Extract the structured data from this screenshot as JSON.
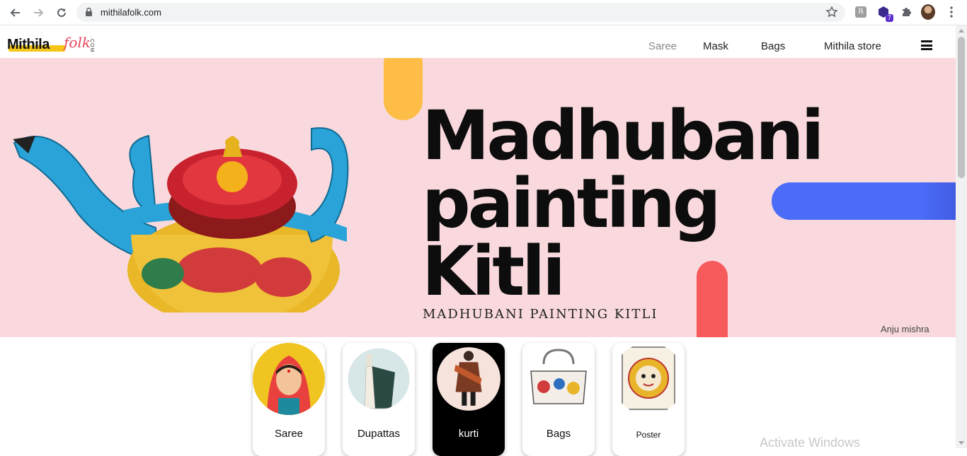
{
  "browser": {
    "url": "mithilafolk.com",
    "extension_badge": "7"
  },
  "site": {
    "logo_text": "Mithila",
    "logo_script": "folk",
    "logo_com": ".COM",
    "menu": [
      {
        "label": "Saree",
        "color": "#888888"
      },
      {
        "label": "Mask",
        "color": "#222222"
      },
      {
        "label": "Bags",
        "color": "#222222"
      },
      {
        "label": "Mithila store",
        "color": "#222222"
      }
    ]
  },
  "hero": {
    "title_lines": [
      "Madhubani",
      "painting",
      "Kitli"
    ],
    "subtitle": "MADHUBANI PAINTING  KITLI",
    "credit": "Anju mishra",
    "bg_color": "#f9d9dd"
  },
  "categories": [
    {
      "label": "Saree",
      "icon": "saree-woman-illustration"
    },
    {
      "label": "Dupattas",
      "icon": "dupatta-mannequin"
    },
    {
      "label": "kurti",
      "icon": "kurti-figure"
    },
    {
      "label": "Bags",
      "icon": "painted-handbag"
    },
    {
      "label": "Poster",
      "icon": "madhubani-poster"
    }
  ],
  "overlay": {
    "activate_windows": "Activate Windows"
  }
}
